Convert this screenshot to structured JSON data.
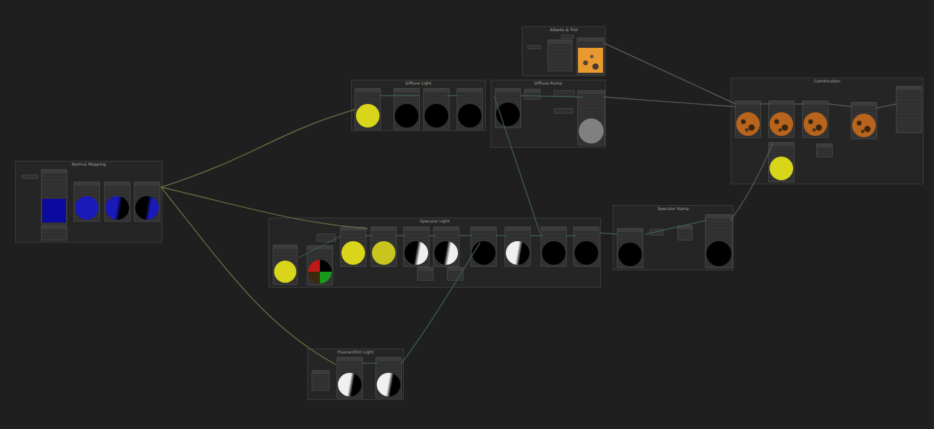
{
  "editor": {
    "kind": "node-graph"
  },
  "groups": [
    {
      "title": "Albedo & Tint",
      "nodes": [
        {
          "preview": "none",
          "color": "#000000"
        },
        {
          "preview": "none",
          "color": "#000000"
        },
        {
          "preview": "none",
          "color": "#000000"
        },
        {
          "preview": "texture",
          "color": "#e89a2e"
        }
      ]
    },
    {
      "title": "Diffuse Light",
      "nodes": [
        {
          "preview": "sphere",
          "color": "#d8d51a"
        },
        {
          "preview": "sphere",
          "color": "#000000"
        },
        {
          "preview": "sphere",
          "color": "#000000"
        },
        {
          "preview": "sphere",
          "color": "#000000"
        }
      ]
    },
    {
      "title": "Diffuse Ramp",
      "nodes": [
        {
          "preview": "sphere",
          "color": "#000000"
        },
        {
          "preview": "none",
          "color": "#000000"
        },
        {
          "preview": "none",
          "color": "#000000"
        },
        {
          "preview": "none",
          "color": "#000000"
        },
        {
          "preview": "sphere",
          "color": "#808080"
        }
      ]
    },
    {
      "title": "Normal Mapping",
      "nodes": [
        {
          "preview": "none",
          "color": "#000000"
        },
        {
          "preview": "square",
          "color": "#0a0aa0"
        },
        {
          "preview": "none",
          "color": "#000000"
        },
        {
          "preview": "sphere",
          "color": "#1a1ab8"
        },
        {
          "preview": "split",
          "color": "#1a1ab8"
        },
        {
          "preview": "split-reverse",
          "color": "#1a1ab8"
        }
      ]
    },
    {
      "title": "Specular Light",
      "nodes": [
        {
          "preview": "sphere",
          "color": "#d8d51a"
        },
        {
          "preview": "none",
          "color": "#000000"
        },
        {
          "preview": "rgb",
          "color": "#c01818"
        },
        {
          "preview": "sphere",
          "color": "#d8d51a"
        },
        {
          "preview": "sphere",
          "color": "#c8c420"
        },
        {
          "preview": "split-reverse",
          "color": "#f0f0f0"
        },
        {
          "preview": "split-reverse",
          "color": "#f0f0f0"
        },
        {
          "preview": "sphere",
          "color": "#000000"
        },
        {
          "preview": "split",
          "color": "#f0f0f0"
        },
        {
          "preview": "sphere",
          "color": "#000000"
        },
        {
          "preview": "sphere",
          "color": "#000000"
        },
        {
          "preview": "none",
          "color": "#000000"
        },
        {
          "preview": "none",
          "color": "#000000"
        }
      ]
    },
    {
      "title": "Specular Ramp",
      "nodes": [
        {
          "preview": "sphere",
          "color": "#000000"
        },
        {
          "preview": "none",
          "color": "#000000"
        },
        {
          "preview": "none",
          "color": "#000000"
        },
        {
          "preview": "sphere",
          "color": "#000000"
        }
      ]
    },
    {
      "title": "Fresnel/Rim Light",
      "nodes": [
        {
          "preview": "none",
          "color": "#000000"
        },
        {
          "preview": "split",
          "color": "#f0f0f0"
        },
        {
          "preview": "split",
          "color": "#f0f0f0"
        }
      ]
    },
    {
      "title": "Combination",
      "nodes": [
        {
          "preview": "textured-sphere",
          "color": "#b8641c"
        },
        {
          "preview": "textured-sphere",
          "color": "#b8641c"
        },
        {
          "preview": "textured-sphere",
          "color": "#b8641c"
        },
        {
          "preview": "textured-sphere",
          "color": "#b8641c"
        },
        {
          "preview": "none",
          "color": "#000000"
        },
        {
          "preview": "sphere",
          "color": "#d8d51a"
        },
        {
          "preview": "none",
          "color": "#000000"
        }
      ]
    }
  ]
}
